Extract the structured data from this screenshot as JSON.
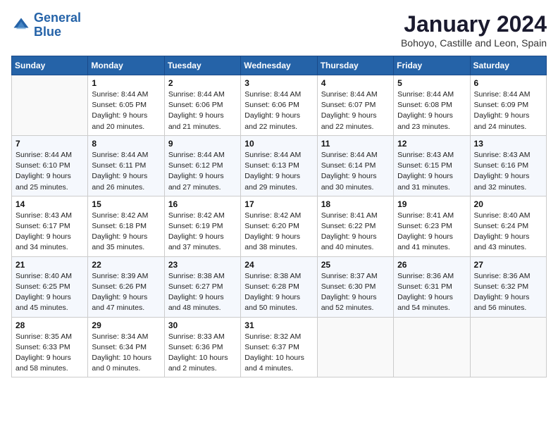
{
  "header": {
    "logo_line1": "General",
    "logo_line2": "Blue",
    "month_title": "January 2024",
    "subtitle": "Bohoyo, Castille and Leon, Spain"
  },
  "days_of_week": [
    "Sunday",
    "Monday",
    "Tuesday",
    "Wednesday",
    "Thursday",
    "Friday",
    "Saturday"
  ],
  "weeks": [
    [
      {
        "day": "",
        "info": ""
      },
      {
        "day": "1",
        "info": "Sunrise: 8:44 AM\nSunset: 6:05 PM\nDaylight: 9 hours\nand 20 minutes."
      },
      {
        "day": "2",
        "info": "Sunrise: 8:44 AM\nSunset: 6:06 PM\nDaylight: 9 hours\nand 21 minutes."
      },
      {
        "day": "3",
        "info": "Sunrise: 8:44 AM\nSunset: 6:06 PM\nDaylight: 9 hours\nand 22 minutes."
      },
      {
        "day": "4",
        "info": "Sunrise: 8:44 AM\nSunset: 6:07 PM\nDaylight: 9 hours\nand 22 minutes."
      },
      {
        "day": "5",
        "info": "Sunrise: 8:44 AM\nSunset: 6:08 PM\nDaylight: 9 hours\nand 23 minutes."
      },
      {
        "day": "6",
        "info": "Sunrise: 8:44 AM\nSunset: 6:09 PM\nDaylight: 9 hours\nand 24 minutes."
      }
    ],
    [
      {
        "day": "7",
        "info": "Sunrise: 8:44 AM\nSunset: 6:10 PM\nDaylight: 9 hours\nand 25 minutes."
      },
      {
        "day": "8",
        "info": "Sunrise: 8:44 AM\nSunset: 6:11 PM\nDaylight: 9 hours\nand 26 minutes."
      },
      {
        "day": "9",
        "info": "Sunrise: 8:44 AM\nSunset: 6:12 PM\nDaylight: 9 hours\nand 27 minutes."
      },
      {
        "day": "10",
        "info": "Sunrise: 8:44 AM\nSunset: 6:13 PM\nDaylight: 9 hours\nand 29 minutes."
      },
      {
        "day": "11",
        "info": "Sunrise: 8:44 AM\nSunset: 6:14 PM\nDaylight: 9 hours\nand 30 minutes."
      },
      {
        "day": "12",
        "info": "Sunrise: 8:43 AM\nSunset: 6:15 PM\nDaylight: 9 hours\nand 31 minutes."
      },
      {
        "day": "13",
        "info": "Sunrise: 8:43 AM\nSunset: 6:16 PM\nDaylight: 9 hours\nand 32 minutes."
      }
    ],
    [
      {
        "day": "14",
        "info": "Sunrise: 8:43 AM\nSunset: 6:17 PM\nDaylight: 9 hours\nand 34 minutes."
      },
      {
        "day": "15",
        "info": "Sunrise: 8:42 AM\nSunset: 6:18 PM\nDaylight: 9 hours\nand 35 minutes."
      },
      {
        "day": "16",
        "info": "Sunrise: 8:42 AM\nSunset: 6:19 PM\nDaylight: 9 hours\nand 37 minutes."
      },
      {
        "day": "17",
        "info": "Sunrise: 8:42 AM\nSunset: 6:20 PM\nDaylight: 9 hours\nand 38 minutes."
      },
      {
        "day": "18",
        "info": "Sunrise: 8:41 AM\nSunset: 6:22 PM\nDaylight: 9 hours\nand 40 minutes."
      },
      {
        "day": "19",
        "info": "Sunrise: 8:41 AM\nSunset: 6:23 PM\nDaylight: 9 hours\nand 41 minutes."
      },
      {
        "day": "20",
        "info": "Sunrise: 8:40 AM\nSunset: 6:24 PM\nDaylight: 9 hours\nand 43 minutes."
      }
    ],
    [
      {
        "day": "21",
        "info": "Sunrise: 8:40 AM\nSunset: 6:25 PM\nDaylight: 9 hours\nand 45 minutes."
      },
      {
        "day": "22",
        "info": "Sunrise: 8:39 AM\nSunset: 6:26 PM\nDaylight: 9 hours\nand 47 minutes."
      },
      {
        "day": "23",
        "info": "Sunrise: 8:38 AM\nSunset: 6:27 PM\nDaylight: 9 hours\nand 48 minutes."
      },
      {
        "day": "24",
        "info": "Sunrise: 8:38 AM\nSunset: 6:28 PM\nDaylight: 9 hours\nand 50 minutes."
      },
      {
        "day": "25",
        "info": "Sunrise: 8:37 AM\nSunset: 6:30 PM\nDaylight: 9 hours\nand 52 minutes."
      },
      {
        "day": "26",
        "info": "Sunrise: 8:36 AM\nSunset: 6:31 PM\nDaylight: 9 hours\nand 54 minutes."
      },
      {
        "day": "27",
        "info": "Sunrise: 8:36 AM\nSunset: 6:32 PM\nDaylight: 9 hours\nand 56 minutes."
      }
    ],
    [
      {
        "day": "28",
        "info": "Sunrise: 8:35 AM\nSunset: 6:33 PM\nDaylight: 9 hours\nand 58 minutes."
      },
      {
        "day": "29",
        "info": "Sunrise: 8:34 AM\nSunset: 6:34 PM\nDaylight: 10 hours\nand 0 minutes."
      },
      {
        "day": "30",
        "info": "Sunrise: 8:33 AM\nSunset: 6:36 PM\nDaylight: 10 hours\nand 2 minutes."
      },
      {
        "day": "31",
        "info": "Sunrise: 8:32 AM\nSunset: 6:37 PM\nDaylight: 10 hours\nand 4 minutes."
      },
      {
        "day": "",
        "info": ""
      },
      {
        "day": "",
        "info": ""
      },
      {
        "day": "",
        "info": ""
      }
    ]
  ]
}
